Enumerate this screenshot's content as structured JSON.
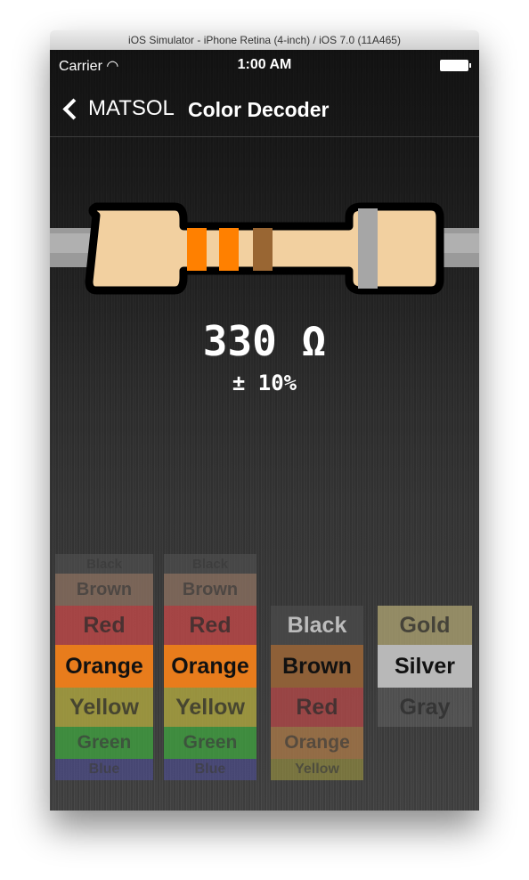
{
  "window_title": "iOS Simulator - iPhone Retina (4-inch) / iOS 7.0 (11A465)",
  "status": {
    "carrier": "Carrier",
    "time": "1:00 AM",
    "wifi_icon": "wifi-icon",
    "battery_icon": "battery-icon"
  },
  "nav": {
    "back_label": "MATSOL",
    "title": "Color Decoder"
  },
  "resistor": {
    "bands": [
      "#ff8000",
      "#ff8000",
      "#996633",
      "#a6a6a6"
    ],
    "body_color": "#f2d0a0"
  },
  "result": {
    "value": "330 Ω",
    "tolerance": "± 10%"
  },
  "pickers": [
    {
      "selected": "Orange",
      "items": [
        {
          "label": "Black",
          "color": "#555555"
        },
        {
          "label": "Brown",
          "color": "#8a7060"
        },
        {
          "label": "Red",
          "color": "#c04848"
        },
        {
          "label": "Orange",
          "color": "#e87c1c"
        },
        {
          "label": "Yellow",
          "color": "#b0a840"
        },
        {
          "label": "Green",
          "color": "#40a040"
        },
        {
          "label": "Blue",
          "color": "#5050a0"
        }
      ]
    },
    {
      "selected": "Orange",
      "items": [
        {
          "label": "Black",
          "color": "#555555"
        },
        {
          "label": "Brown",
          "color": "#8a7060"
        },
        {
          "label": "Red",
          "color": "#c04848"
        },
        {
          "label": "Orange",
          "color": "#e87c1c"
        },
        {
          "label": "Yellow",
          "color": "#b0a840"
        },
        {
          "label": "Green",
          "color": "#40a040"
        },
        {
          "label": "Blue",
          "color": "#5050a0"
        }
      ]
    },
    {
      "selected": "Brown",
      "items": [
        {
          "label": "Black",
          "color": "#4a4a4a"
        },
        {
          "label": "Brown",
          "color": "#8e6038"
        },
        {
          "label": "Red",
          "color": "#b04848"
        },
        {
          "label": "Orange",
          "color": "#a87848"
        },
        {
          "label": "Yellow",
          "color": "#a8a040"
        }
      ]
    },
    {
      "selected": "Silver",
      "items": [
        {
          "label": "Gold",
          "color": "#aaa070"
        },
        {
          "label": "Silver",
          "color": "#b8b8b8"
        },
        {
          "label": "Gray",
          "color": "#888888"
        }
      ]
    }
  ]
}
